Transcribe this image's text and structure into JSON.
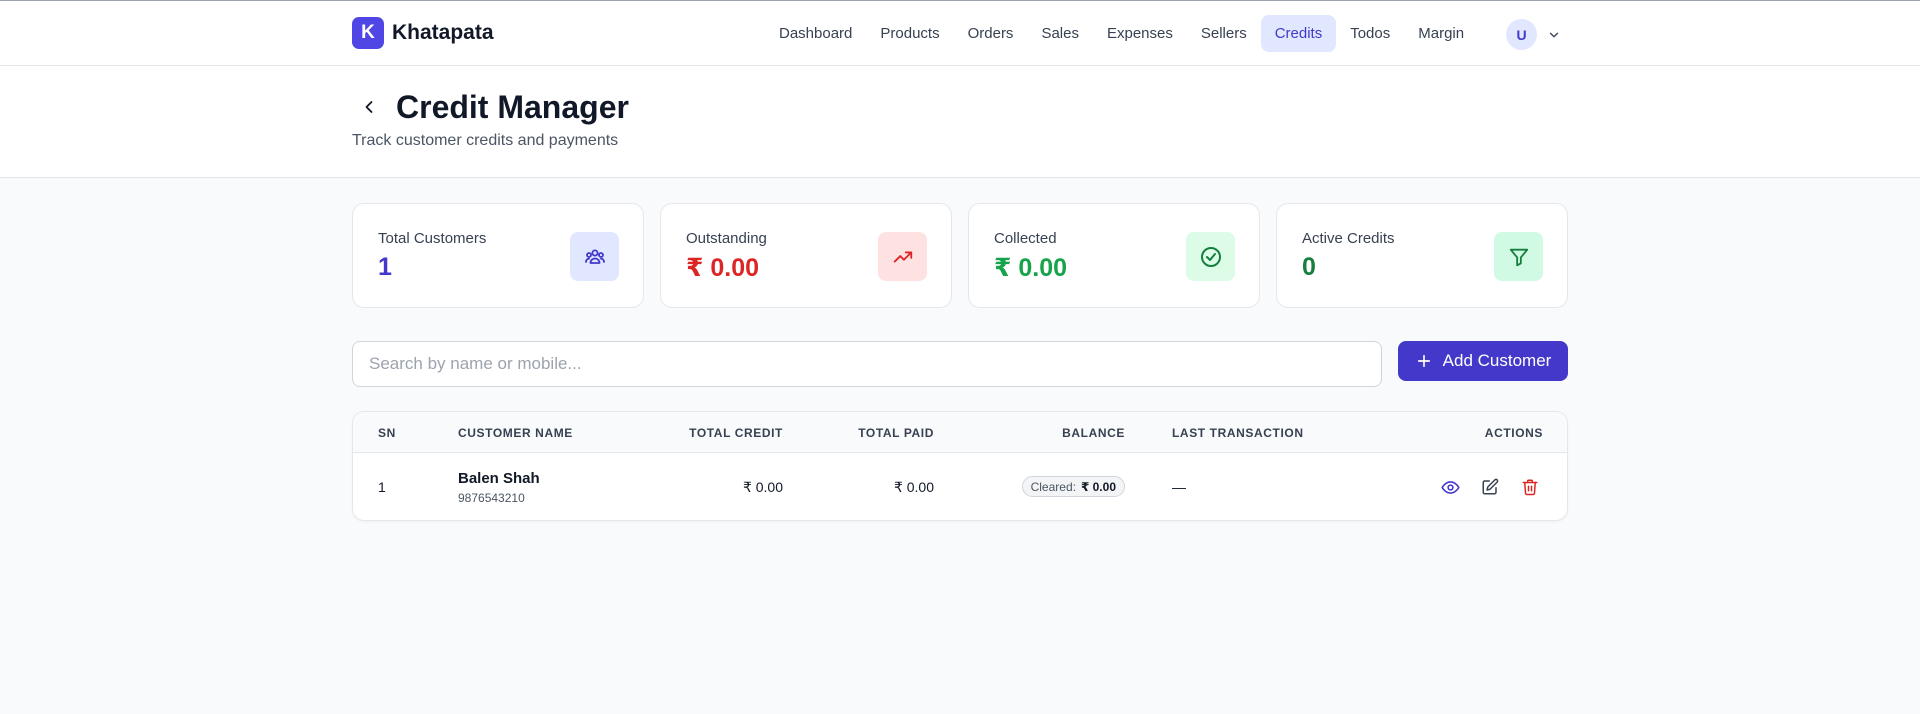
{
  "app": {
    "logo_letter": "K",
    "name": "Khatapata"
  },
  "nav": {
    "items": [
      {
        "label": "Dashboard"
      },
      {
        "label": "Products"
      },
      {
        "label": "Orders"
      },
      {
        "label": "Sales"
      },
      {
        "label": "Expenses"
      },
      {
        "label": "Sellers"
      },
      {
        "label": "Credits",
        "active": true
      },
      {
        "label": "Todos"
      },
      {
        "label": "Margin"
      }
    ],
    "user_initial": "U"
  },
  "header": {
    "title": "Credit Manager",
    "subtitle": "Track customer credits and payments"
  },
  "stats": [
    {
      "label": "Total Customers",
      "value": "1",
      "color": "#4338ca",
      "icon": "users-icon",
      "icon_bg": "#e0e7ff"
    },
    {
      "label": "Outstanding",
      "value": "₹ 0.00",
      "color": "#dc2626",
      "icon": "trending-up-icon",
      "icon_bg": "#fee2e2"
    },
    {
      "label": "Collected",
      "value": "₹ 0.00",
      "color": "#16a34a",
      "icon": "check-circle-icon",
      "icon_bg": "#dcfce7"
    },
    {
      "label": "Active Credits",
      "value": "0",
      "color": "#15803d",
      "icon": "filter-icon",
      "icon_bg": "#d1fae5"
    }
  ],
  "search": {
    "placeholder": "Search by name or mobile...",
    "value": ""
  },
  "add_button": {
    "label": "Add Customer"
  },
  "table": {
    "headers": {
      "sn": "SN",
      "name": "CUSTOMER NAME",
      "total_credit": "TOTAL CREDIT",
      "total_paid": "TOTAL PAID",
      "balance": "BALANCE",
      "last_transaction": "LAST TRANSACTION",
      "actions": "ACTIONS"
    },
    "rows": [
      {
        "sn": "1",
        "name": "Balen Shah",
        "mobile": "9876543210",
        "total_credit": "₹ 0.00",
        "total_paid": "₹ 0.00",
        "balance_label": "Cleared:",
        "balance_amount": "₹ 0.00",
        "last_transaction": "—"
      }
    ]
  },
  "colors": {
    "accent": "#4338ca",
    "danger": "#dc2626",
    "success": "#16a34a"
  }
}
